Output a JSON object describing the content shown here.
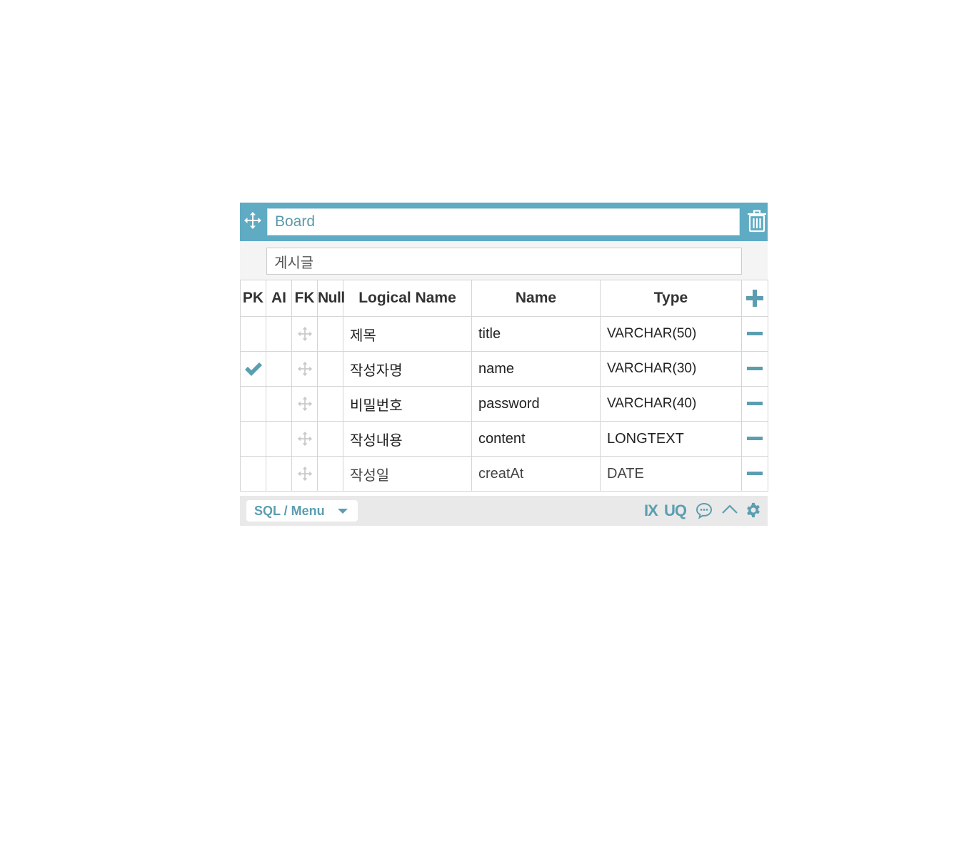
{
  "table": {
    "name": "Board",
    "comment": "게시글"
  },
  "columns_header": {
    "pk": "PK",
    "ai": "AI",
    "fk": "FK",
    "null": "Null",
    "logical_name": "Logical Name",
    "name": "Name",
    "type": "Type"
  },
  "rows": [
    {
      "logical_name": "제목",
      "name": "title",
      "type": "VARCHAR(50)",
      "pk": false
    },
    {
      "logical_name": "작성자명",
      "name": "name",
      "type": "VARCHAR(30)",
      "pk": true
    },
    {
      "logical_name": "비밀번호",
      "name": "password",
      "type": "VARCHAR(40)",
      "pk": false
    },
    {
      "logical_name": "작성내용",
      "name": "content",
      "type": "LONGTEXT",
      "pk": false
    },
    {
      "logical_name": "작성일",
      "name": "creatAt",
      "type": "DATE",
      "pk": false
    }
  ],
  "footer": {
    "sql_menu_label": "SQL / Menu",
    "ix_label": "IX",
    "uq_label": "UQ"
  },
  "colors": {
    "accent": "#5eabc3",
    "icon": "#5b9eb0",
    "footer_bg": "#e9e9e9"
  },
  "icons": [
    "move-icon",
    "trash-icon",
    "plus-icon",
    "minus-icon",
    "check-icon",
    "comment-icon",
    "chevron-up-icon",
    "gear-icon",
    "caret-down-icon"
  ]
}
